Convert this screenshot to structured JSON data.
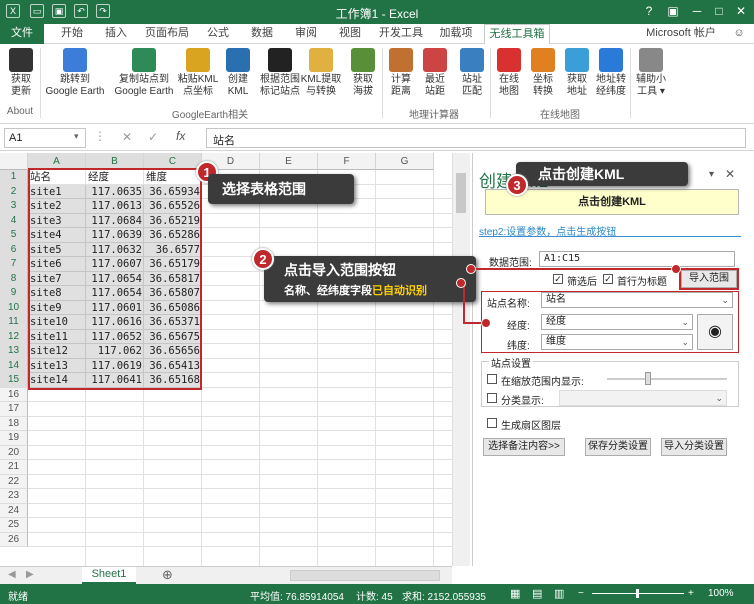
{
  "window": {
    "title": "工作簿1 - Excel",
    "help": "?",
    "minimize": "─",
    "maximize": "□",
    "close": "✕",
    "restore": "▣"
  },
  "ribbon_tabs": [
    "文件",
    "开始",
    "插入",
    "页面布局",
    "公式",
    "数据",
    "审阅",
    "视图",
    "开发工具",
    "加载项",
    "无线工具箱"
  ],
  "account": "Microsoft 帐户",
  "ribbon": {
    "buttons": [
      {
        "label": "获取\n更新",
        "icon": "qrcode-icon",
        "color": "#333333"
      },
      {
        "label": "跳转到\nGoogle Earth",
        "icon": "paper-plane-icon",
        "color": "#3b7dd8"
      },
      {
        "label": "复制站点到\nGoogle Earth",
        "icon": "map-pin-icon",
        "color": "#2e8b57"
      },
      {
        "label": "粘贴KML\n点坐标",
        "icon": "paste-kml-icon",
        "color": "#d9a520"
      },
      {
        "label": "创建\nKML",
        "icon": "globe-icon",
        "color": "#2a6fb0"
      },
      {
        "label": "根据范围\n标记站点",
        "icon": "marker-icon",
        "color": "#222222"
      },
      {
        "label": "KML提取\n与转换",
        "icon": "folder-icon",
        "color": "#e0b040"
      },
      {
        "label": "获取\n海拔",
        "icon": "mountain-icon",
        "color": "#5a8f3a"
      },
      {
        "label": "计算\n距离",
        "icon": "ruler-icon",
        "color": "#c07030"
      },
      {
        "label": "最近\n站距",
        "icon": "nearest-icon",
        "color": "#cc4444"
      },
      {
        "label": "站址\n匹配",
        "icon": "site-match-icon",
        "color": "#3a7fc0"
      },
      {
        "label": "在线\n地图",
        "icon": "baidu-map-icon",
        "color": "#d93030"
      },
      {
        "label": "坐标\n转换",
        "icon": "coordinate-icon",
        "color": "#e08020"
      },
      {
        "label": "获取\n地址",
        "icon": "address-icon",
        "color": "#3a9fd8"
      },
      {
        "label": "地址转\n经纬度",
        "icon": "geocode-icon",
        "color": "#2a7ad8"
      },
      {
        "label": "辅助小\n工具 ▾",
        "icon": "tool-icon",
        "color": "#888888"
      }
    ],
    "groups": [
      "About",
      "GoogleEarth相关",
      "地理计算器",
      "在线地图"
    ]
  },
  "formula_bar": {
    "cell": "A1",
    "fx": "fx",
    "cancel": "✕",
    "enter": "✓",
    "value": "站名"
  },
  "grid": {
    "columns": [
      "A",
      "B",
      "C",
      "D",
      "E",
      "F",
      "G"
    ],
    "rows": [
      "1",
      "2",
      "3",
      "4",
      "5",
      "6",
      "7",
      "8",
      "9",
      "10",
      "11",
      "12",
      "13",
      "14",
      "15",
      "16",
      "17",
      "18",
      "19",
      "20",
      "21",
      "22",
      "23",
      "24",
      "25",
      "26"
    ],
    "header": [
      "站名",
      "经度",
      "维度"
    ],
    "data": [
      [
        "site1",
        "117.0635",
        "36.65934"
      ],
      [
        "site2",
        "117.0613",
        "36.65526"
      ],
      [
        "site3",
        "117.0684",
        "36.65219"
      ],
      [
        "site4",
        "117.0639",
        "36.65286"
      ],
      [
        "site5",
        "117.0632",
        "36.6577"
      ],
      [
        "site6",
        "117.0607",
        "36.65179"
      ],
      [
        "site7",
        "117.0654",
        "36.65817"
      ],
      [
        "site8",
        "117.0654",
        "36.65807"
      ],
      [
        "site9",
        "117.0601",
        "36.65086"
      ],
      [
        "site10",
        "117.0616",
        "36.65371"
      ],
      [
        "site11",
        "117.0652",
        "36.65675"
      ],
      [
        "site12",
        "117.062",
        "36.65656"
      ],
      [
        "site13",
        "117.0619",
        "36.65413"
      ],
      [
        "site14",
        "117.0641",
        "36.65168"
      ]
    ]
  },
  "sheet": {
    "tab": "Sheet1",
    "add": "⊕"
  },
  "status": {
    "ready": "就绪",
    "average": "平均值: 76.85914054",
    "count": "计数: 45",
    "sum": "求和: 2152.055935",
    "zoom": "100%"
  },
  "pane": {
    "title": "创建KML",
    "close": "✕",
    "pin": "▾",
    "create_button": "点击创建KML",
    "step2": "step2:设置参数，点击生成按钮",
    "range_label": "数据范围:",
    "range_value": "A1:C15",
    "filter_label": "筛选后",
    "header_label": "首行为标题",
    "import_button": "导入范围",
    "site_name_label": "站点名称:",
    "site_name_value": "站名",
    "lon_label": "经度:",
    "lon_value": "经度",
    "lat_label": "纬度:",
    "lat_value": "维度",
    "site_settings": "站点设置",
    "zoom_show": "在缩放范围内显示:",
    "classify": "分类显示:",
    "sector": "生成扇区图层",
    "remark_button": "选择备注内容>>",
    "save_class_button": "保存分类设置",
    "import_class_button": "导入分类设置"
  },
  "callouts": {
    "c1": {
      "num": "1",
      "text": "选择表格范围"
    },
    "c2": {
      "num": "2",
      "line1": "点击导入范围按钮",
      "line2a": "名称、经纬度字段",
      "line2b": "已自动识别"
    },
    "c3": {
      "num": "3",
      "text": "点击创建KML"
    }
  },
  "colors": {
    "excel_green": "#217346",
    "callout_red": "#c0282c",
    "highlight_yellow": "#ffd200"
  }
}
